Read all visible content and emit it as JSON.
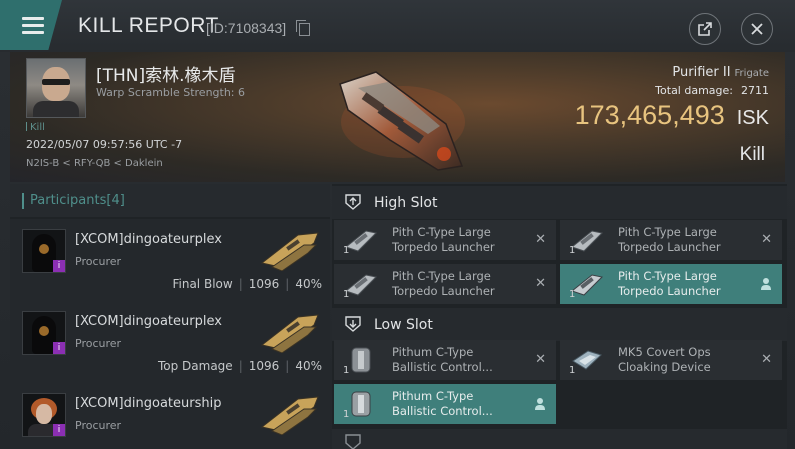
{
  "header": {
    "title": "KILL REPORT",
    "id_text": "[ID:7108343]"
  },
  "victim": {
    "name": "[THN]索林.橡木盾",
    "warp_scramble": "Warp Scramble Strength: 6",
    "tag": "Kill",
    "date": "2022/05/07 09:57:56 UTC -7",
    "location": "N2IS-B < RFY-QB < Daklein",
    "ship_name": "Purifier II",
    "ship_class": "Frigate",
    "total_damage_label": "Total damage:",
    "total_damage": "2711",
    "isk_value": "173,465,493",
    "isk_unit": "ISK",
    "result": "Kill"
  },
  "participants": {
    "title": "Participants",
    "count": "[4]",
    "rows": [
      {
        "name": "[XCOM]dingoateurplex",
        "ship": "Procurer",
        "role": "Final Blow",
        "damage": "1096",
        "percent": "40%"
      },
      {
        "name": "[XCOM]dingoateurplex",
        "ship": "Procurer",
        "role": "Top Damage",
        "damage": "1096",
        "percent": "40%"
      },
      {
        "name": "[XCOM]dingoateurship",
        "ship": "Procurer"
      }
    ],
    "badge": "i"
  },
  "fitting": {
    "high_slot": {
      "title": "High Slot",
      "modules": [
        {
          "line1": "Pith C-Type Large",
          "line2": "Torpedo Launcher",
          "qty": "1",
          "state": "destroyed"
        },
        {
          "line1": "Pith C-Type Large",
          "line2": "Torpedo Launcher",
          "qty": "1",
          "state": "destroyed"
        },
        {
          "line1": "Pith C-Type Large",
          "line2": "Torpedo Launcher",
          "qty": "1",
          "state": "destroyed"
        },
        {
          "line1": "Pith C-Type Large",
          "line2": "Torpedo Launcher",
          "qty": "1",
          "state": "dropped"
        }
      ]
    },
    "low_slot": {
      "title": "Low Slot",
      "modules": [
        {
          "line1": "Pithum C-Type",
          "line2": "Ballistic Control...",
          "qty": "1",
          "state": "destroyed"
        },
        {
          "line1": "MK5 Covert Ops",
          "line2": "Cloaking Device",
          "qty": "1",
          "state": "destroyed"
        },
        {
          "line1": "Pithum C-Type",
          "line2": "Ballistic Control...",
          "qty": "1",
          "state": "dropped"
        }
      ]
    },
    "destroyed_symbol": "✕"
  },
  "colors": {
    "accent": "#3f7f7b",
    "isk": "#e8c47f",
    "badge": "#8b2fb3"
  },
  "icons": [
    "menu-icon",
    "share-icon",
    "close-icon",
    "copy-icon",
    "high-slot-icon",
    "low-slot-icon",
    "torpedo-launcher-icon",
    "ballistic-control-icon",
    "cloaking-device-icon",
    "pilot-icon"
  ]
}
